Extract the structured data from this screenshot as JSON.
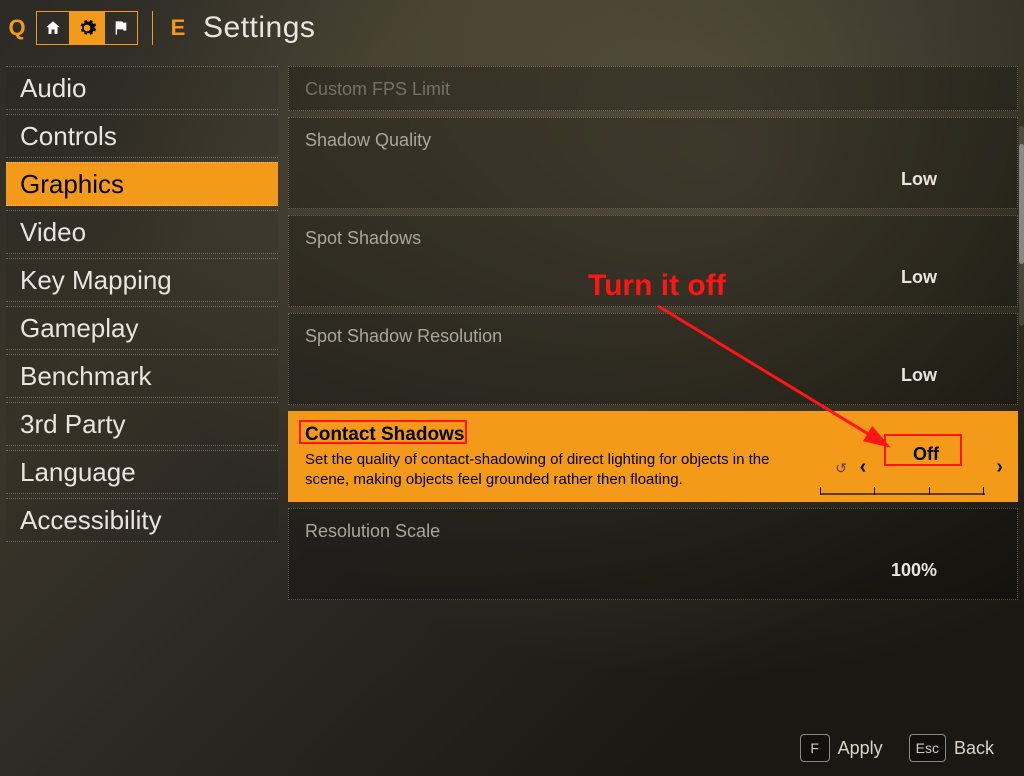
{
  "top": {
    "key_q": "Q",
    "key_e": "E",
    "title": "Settings",
    "tabs": [
      "home",
      "gear",
      "flag"
    ]
  },
  "sidebar": {
    "items": [
      {
        "label": "Audio"
      },
      {
        "label": "Controls"
      },
      {
        "label": "Graphics",
        "active": true
      },
      {
        "label": "Video"
      },
      {
        "label": "Key Mapping"
      },
      {
        "label": "Gameplay"
      },
      {
        "label": "Benchmark"
      },
      {
        "label": "3rd Party"
      },
      {
        "label": "Language"
      },
      {
        "label": "Accessibility"
      }
    ]
  },
  "settings": [
    {
      "label": "Custom FPS Limit",
      "value": "",
      "dim": true,
      "tall": false
    },
    {
      "label": "Shadow Quality",
      "value": "Low",
      "tall": true
    },
    {
      "label": "Spot Shadows",
      "value": "Low",
      "tall": true
    },
    {
      "label": "Spot Shadow Resolution",
      "value": "Low",
      "tall": true
    },
    {
      "label": "Contact Shadows",
      "value": "Off",
      "selected": true,
      "desc": "Set the quality of contact-shadowing of direct lighting for objects in the scene, making objects feel grounded rather then floating."
    },
    {
      "label": "Resolution Scale",
      "value": "100%",
      "tall": true
    }
  ],
  "arrows": {
    "left": "‹",
    "right": "›"
  },
  "footer": {
    "apply": {
      "key": "F",
      "label": "Apply"
    },
    "back": {
      "key": "Esc",
      "label": "Back"
    }
  },
  "annotation": {
    "text": "Turn it off"
  }
}
